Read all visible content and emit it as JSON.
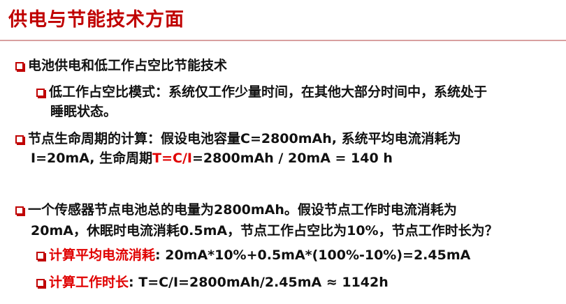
{
  "title": "供电与节能技术方面",
  "colors": {
    "accent": "#c00000",
    "highlight": "#e00000",
    "rule": "#d8a0a0"
  },
  "items": {
    "b1": "电池供电和低工作占空比节能技术",
    "b1_1_line1": "低工作占空比模式：系统仅工作少量时间，在其他大部分时间中，系统处于",
    "b1_1_line2": "睡眠状态。",
    "b2_line1": "节点生命周期的计算：假设电池容量C=2800mAh, 系统平均电流消耗为",
    "b2_line2_pre": "I=20mA, 生命周期",
    "b2_line2_formula": "T=C/I",
    "b2_line2_post": "=2800mAh / 20mA = 140 h",
    "b3_line1": "一个传感器节点电池总的电量为2800mAh。假设节点工作时电流消耗为",
    "b3_line2": "20mA，休眠时电流消耗0.5mA，节点工作占空比为10%，节点工作时长为？",
    "b3_1_label": "计算平均电流消耗",
    "b3_1_value": ": 20mA*10%+0.5mA*(100%-10%)=2.45mA",
    "b3_2_label": "计算工作时长",
    "b3_2_value": ": T=C/I=2800mAh/2.45mA ≈ 1142h"
  }
}
